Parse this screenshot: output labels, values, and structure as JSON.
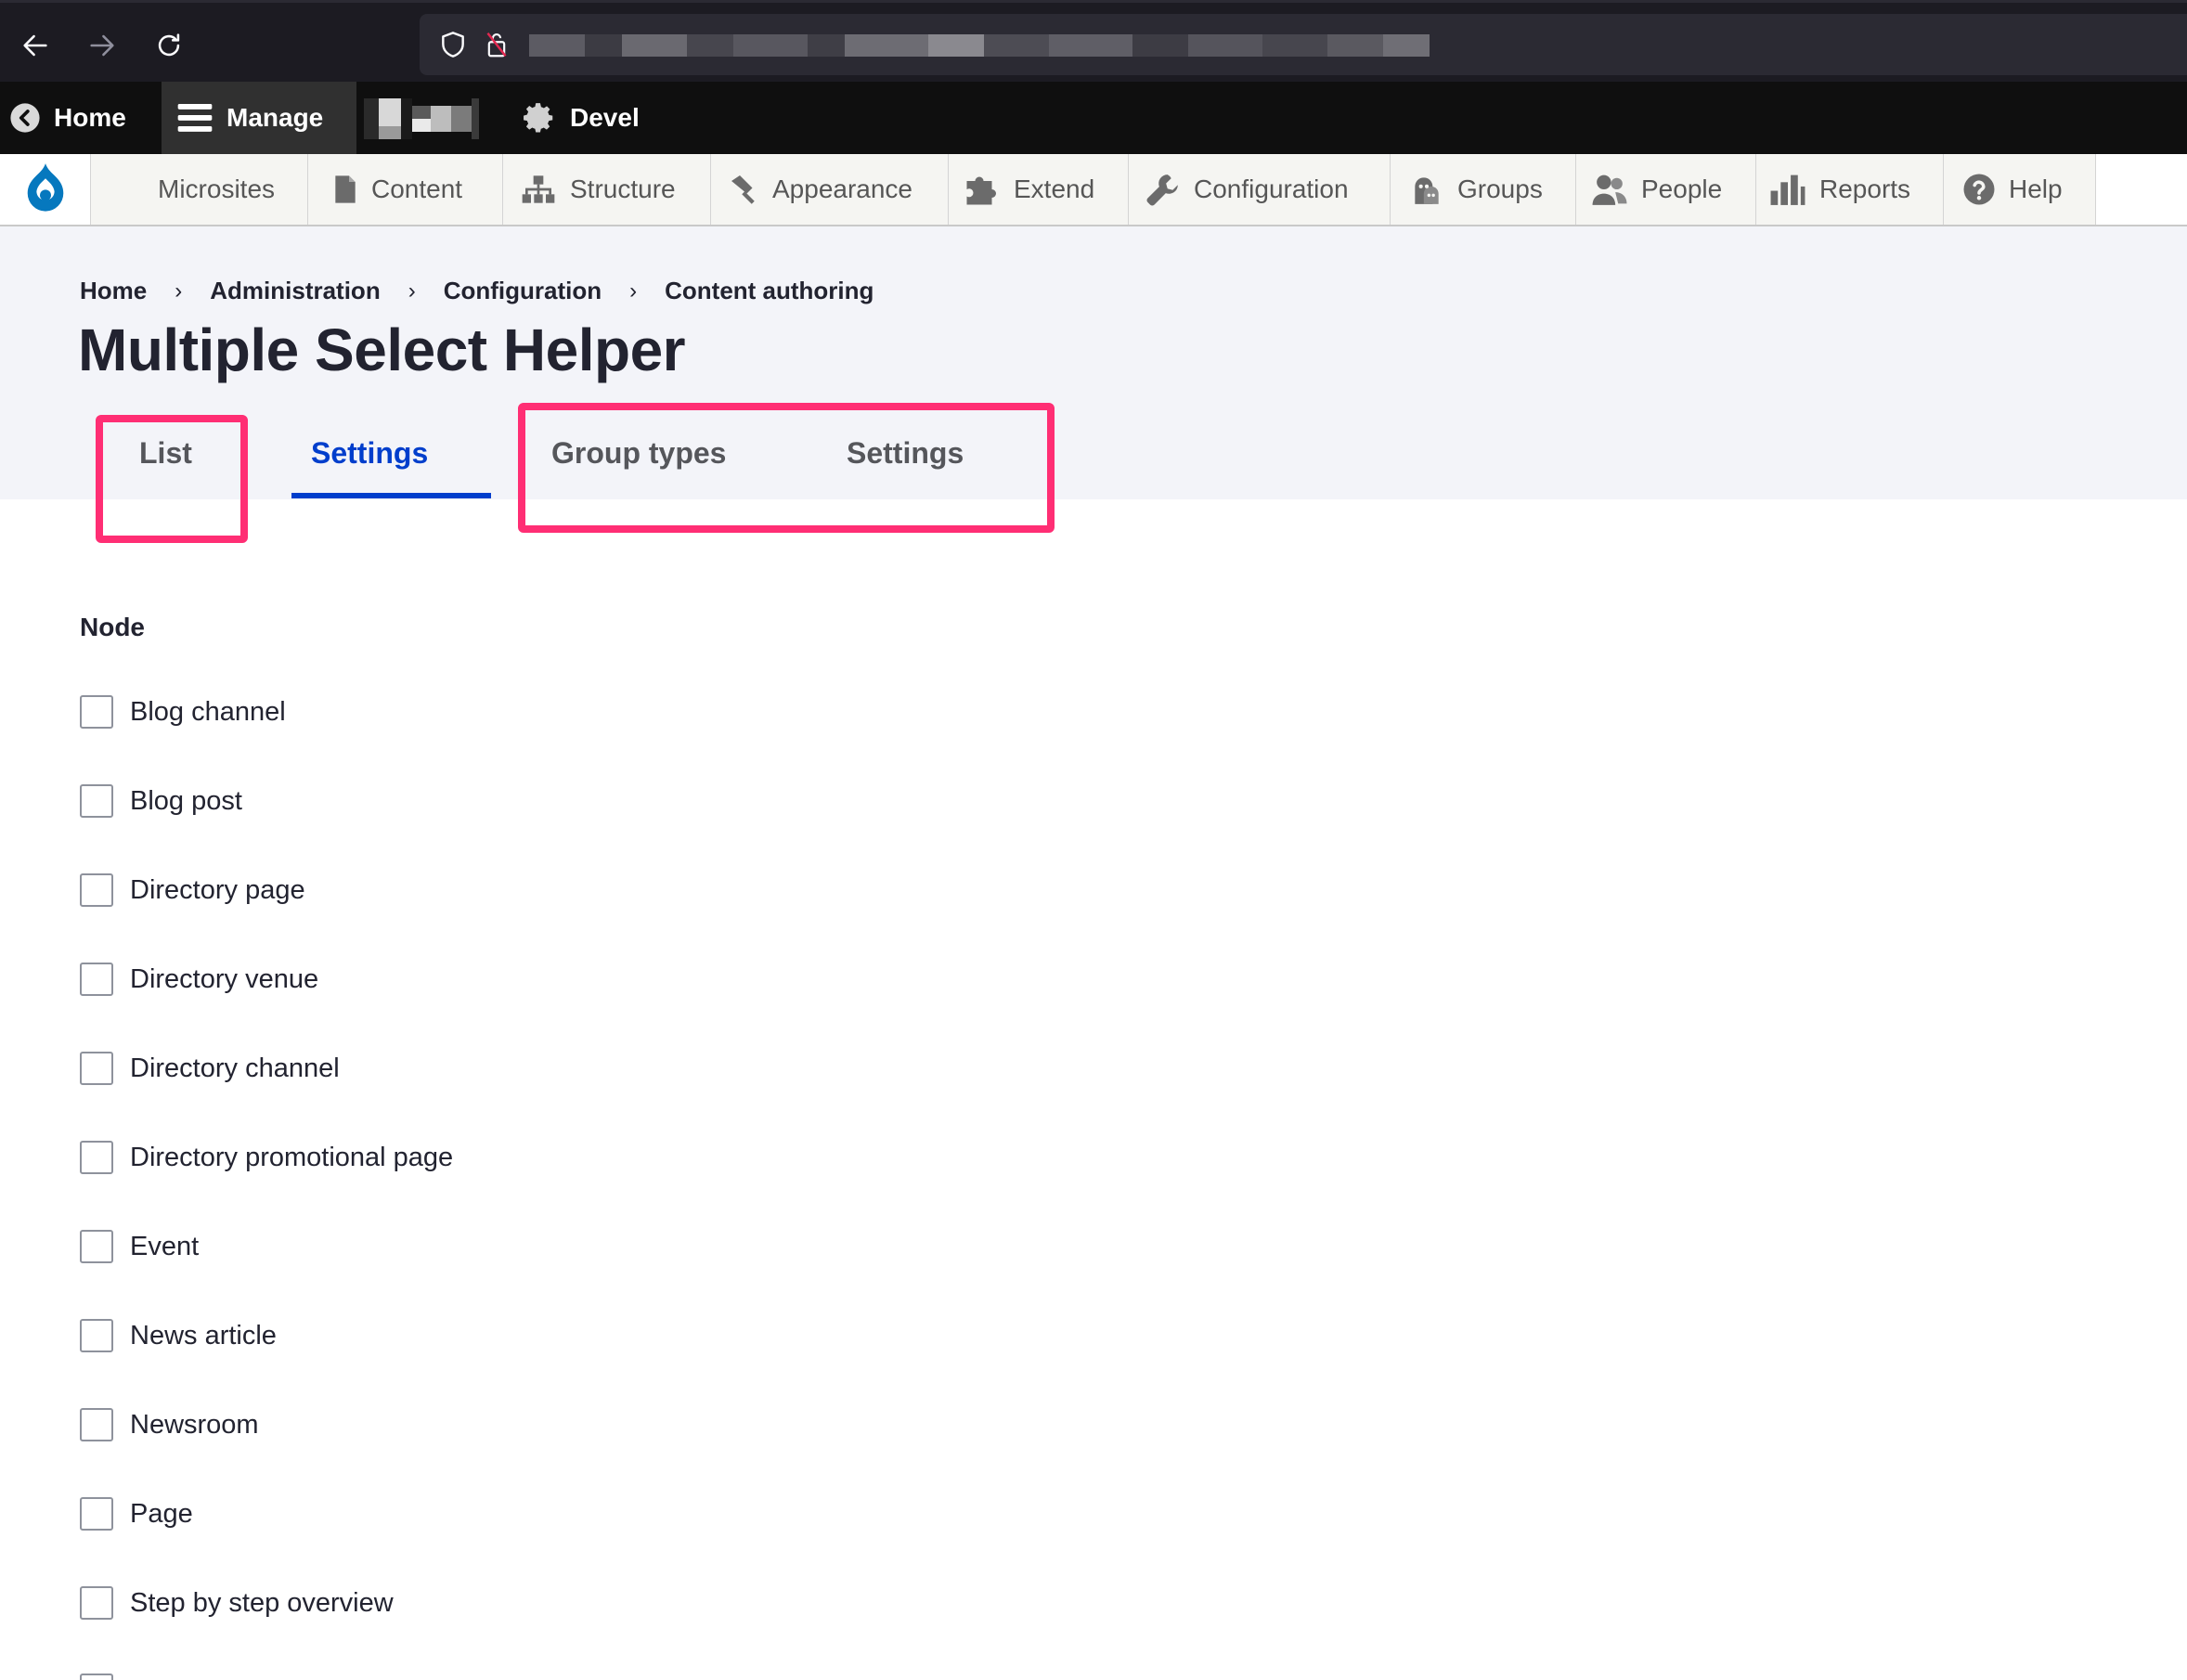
{
  "toolbar": {
    "home_label": "Home",
    "manage_label": "Manage",
    "devel_label": "Devel"
  },
  "admin_menu": {
    "microsites": "Microsites",
    "content": "Content",
    "structure": "Structure",
    "appearance": "Appearance",
    "extend": "Extend",
    "configuration": "Configuration",
    "groups": "Groups",
    "people": "People",
    "reports": "Reports",
    "help": "Help"
  },
  "breadcrumb": {
    "items": [
      "Home",
      "Administration",
      "Configuration",
      "Content authoring"
    ],
    "separator": "›"
  },
  "page": {
    "title": "Multiple Select Helper"
  },
  "tabs": {
    "primary": [
      "List",
      "Settings"
    ],
    "secondary": [
      "Group types",
      "Settings"
    ],
    "active": "Settings"
  },
  "section": {
    "title": "Node",
    "options": [
      "Blog channel",
      "Blog post",
      "Directory page",
      "Directory venue",
      "Directory channel",
      "Directory promotional page",
      "Event",
      "News article",
      "Newsroom",
      "Page",
      "Step by step overview"
    ]
  },
  "colors": {
    "accent_blue": "#003ecc",
    "highlight": "#ff2e74",
    "toolbar_bg": "#0f0f0f",
    "drupal_blue": "#0678be"
  }
}
